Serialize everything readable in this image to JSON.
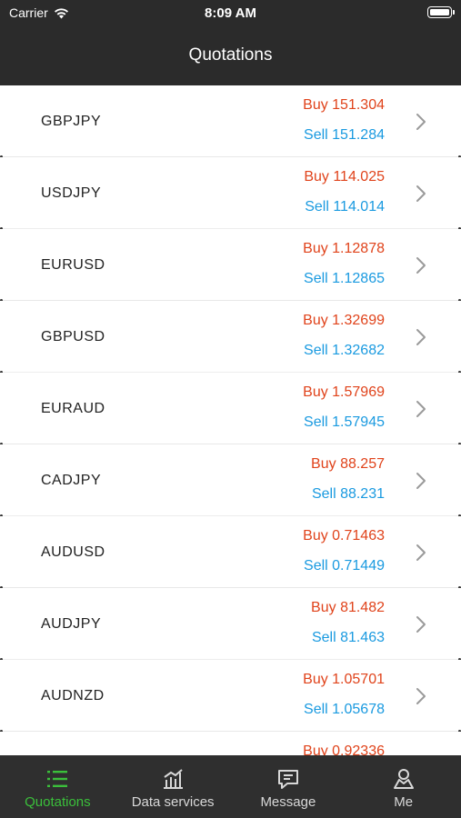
{
  "status_bar": {
    "carrier": "Carrier",
    "time": "8:09 AM"
  },
  "nav": {
    "title": "Quotations"
  },
  "quotes": [
    {
      "symbol": "GBPJPY",
      "buy": "Buy 151.304",
      "sell": "Sell 151.284"
    },
    {
      "symbol": "USDJPY",
      "buy": "Buy 114.025",
      "sell": "Sell 114.014"
    },
    {
      "symbol": "EURUSD",
      "buy": "Buy 1.12878",
      "sell": "Sell 1.12865"
    },
    {
      "symbol": "GBPUSD",
      "buy": "Buy 1.32699",
      "sell": "Sell 1.32682"
    },
    {
      "symbol": "EURAUD",
      "buy": "Buy 1.57969",
      "sell": "Sell 1.57945"
    },
    {
      "symbol": "CADJPY",
      "buy": "Buy 88.257",
      "sell": "Sell 88.231"
    },
    {
      "symbol": "AUDUSD",
      "buy": "Buy 0.71463",
      "sell": "Sell 0.71449"
    },
    {
      "symbol": "AUDJPY",
      "buy": "Buy 81.482",
      "sell": "Sell 81.463"
    },
    {
      "symbol": "AUDNZD",
      "buy": "Buy 1.05701",
      "sell": "Sell 1.05678"
    },
    {
      "symbol": "",
      "buy": "Buy 0.92336",
      "sell": ""
    }
  ],
  "colors": {
    "buy": "#e0431b",
    "sell": "#1a9ae0",
    "tab_active": "#3bbf3b",
    "bar_bg": "#2b2b2b"
  },
  "tabs": [
    {
      "label": "Quotations",
      "icon": "list-icon",
      "active": true
    },
    {
      "label": "Data services",
      "icon": "chart-icon",
      "active": false
    },
    {
      "label": "Message",
      "icon": "message-icon",
      "active": false
    },
    {
      "label": "Me",
      "icon": "person-icon",
      "active": false
    }
  ]
}
